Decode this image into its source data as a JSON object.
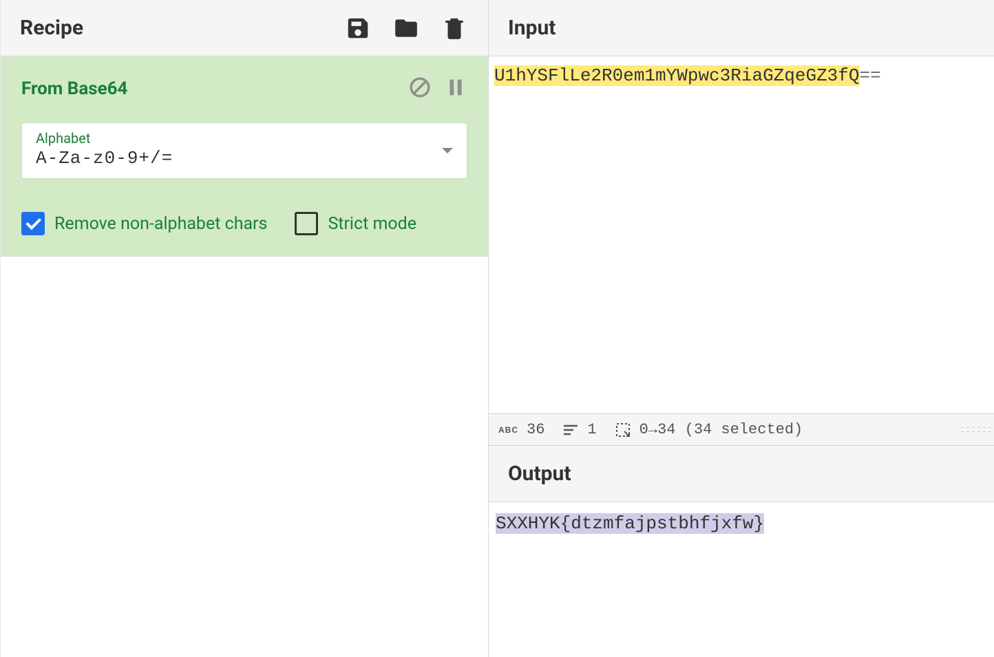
{
  "recipe": {
    "header_title": "Recipe",
    "operation": {
      "title": "From Base64",
      "alphabet_label": "Alphabet",
      "alphabet_value": "A-Za-z0-9+/=",
      "remove_label": "Remove non-alphabet chars",
      "remove_checked": true,
      "strict_label": "Strict mode",
      "strict_checked": false
    }
  },
  "input": {
    "header_title": "Input",
    "highlighted": "U1hYSFlLe2R0em1mYWpwc3RiaGZqeGZ3fQ",
    "tail": "=="
  },
  "status": {
    "char_count": "36",
    "line_count": "1",
    "selection": "0→34 (34 selected)"
  },
  "output": {
    "header_title": "Output",
    "text": "SXXHYK{dtzmfajpstbhfjxfw}"
  }
}
